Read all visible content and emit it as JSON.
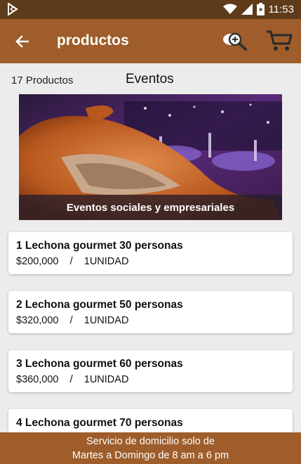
{
  "status_bar": {
    "time": "11:53",
    "icons": [
      "play-store-icon",
      "wifi-icon",
      "signal-icon",
      "battery-icon"
    ]
  },
  "app_bar": {
    "title": "productos",
    "icons": [
      "back-arrow-icon",
      "search-plus-icon",
      "cart-icon"
    ]
  },
  "sub_header": {
    "count": "17 Productos",
    "category": "Eventos"
  },
  "banner": {
    "caption": "Eventos sociales y empresariales"
  },
  "products": [
    {
      "name": "1 Lechona gourmet 30 personas",
      "price": "$200,000",
      "sep": "/",
      "unit": "1UNIDAD"
    },
    {
      "name": "2 Lechona gourmet 50 personas",
      "price": "$320,000",
      "sep": "/",
      "unit": "1UNIDAD"
    },
    {
      "name": "3 Lechona gourmet 60 personas",
      "price": "$360,000",
      "sep": "/",
      "unit": "1UNIDAD"
    },
    {
      "name": "4 Lechona gourmet 70 personas"
    }
  ],
  "footer": {
    "line1": "Servicio de domicilio solo de",
    "line2": "Martes a Domingo de 8 am a 6 pm"
  },
  "colors": {
    "status_bar": "#5e3b1a",
    "app_bar": "#9e5d2a",
    "background": "#ececec"
  }
}
